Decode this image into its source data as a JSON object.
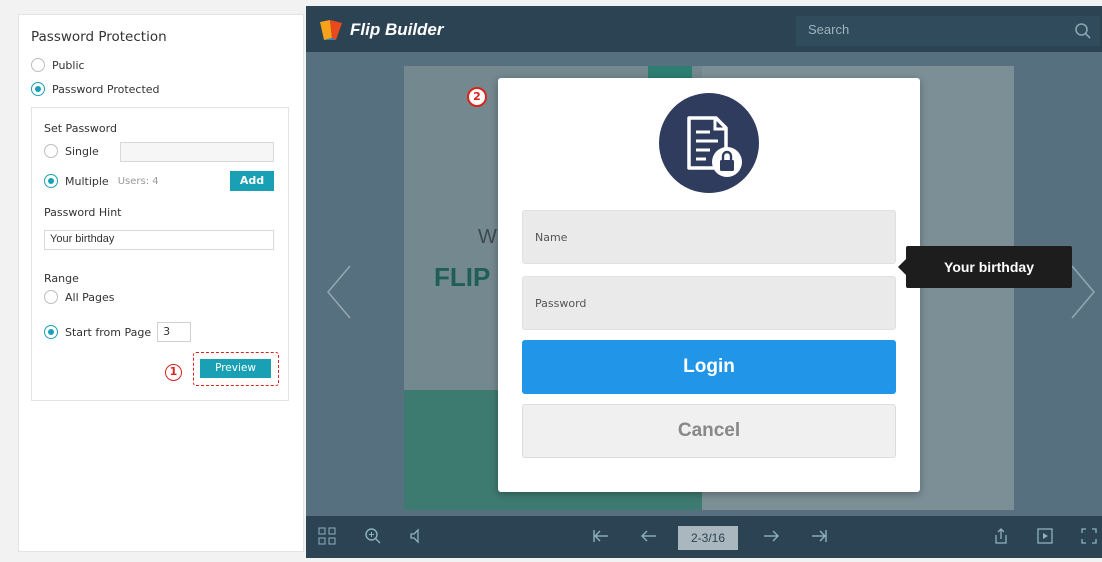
{
  "settings": {
    "title": "Password Protection",
    "opt_public": "Public",
    "opt_protected": "Password Protected",
    "set_password_label": "Set Password",
    "opt_single": "Single",
    "opt_multiple": "Multiple",
    "users_count": "Users: 4",
    "add_label": "Add",
    "hint_label": "Password Hint",
    "hint_value": "Your birthday",
    "range_label": "Range",
    "opt_all_pages": "All Pages",
    "opt_start_from": "Start from Page",
    "start_page": "3",
    "preview_label": "Preview",
    "step1": "1"
  },
  "viewer": {
    "brand": "Flip Builder",
    "search_placeholder": "Search",
    "page_indicator": "2-3/16",
    "page_text_w": "W",
    "page_text_flip": "FLIP"
  },
  "dialog": {
    "step2": "2",
    "name_placeholder": "Name",
    "password_placeholder": "Password",
    "login_label": "Login",
    "cancel_label": "Cancel",
    "tooltip_hint": "Your birthday"
  },
  "colors": {
    "accent": "#1aa0b5",
    "login_blue": "#2196e8",
    "annotation_red": "#d9231f",
    "viewer_dark": "#2b4353"
  }
}
